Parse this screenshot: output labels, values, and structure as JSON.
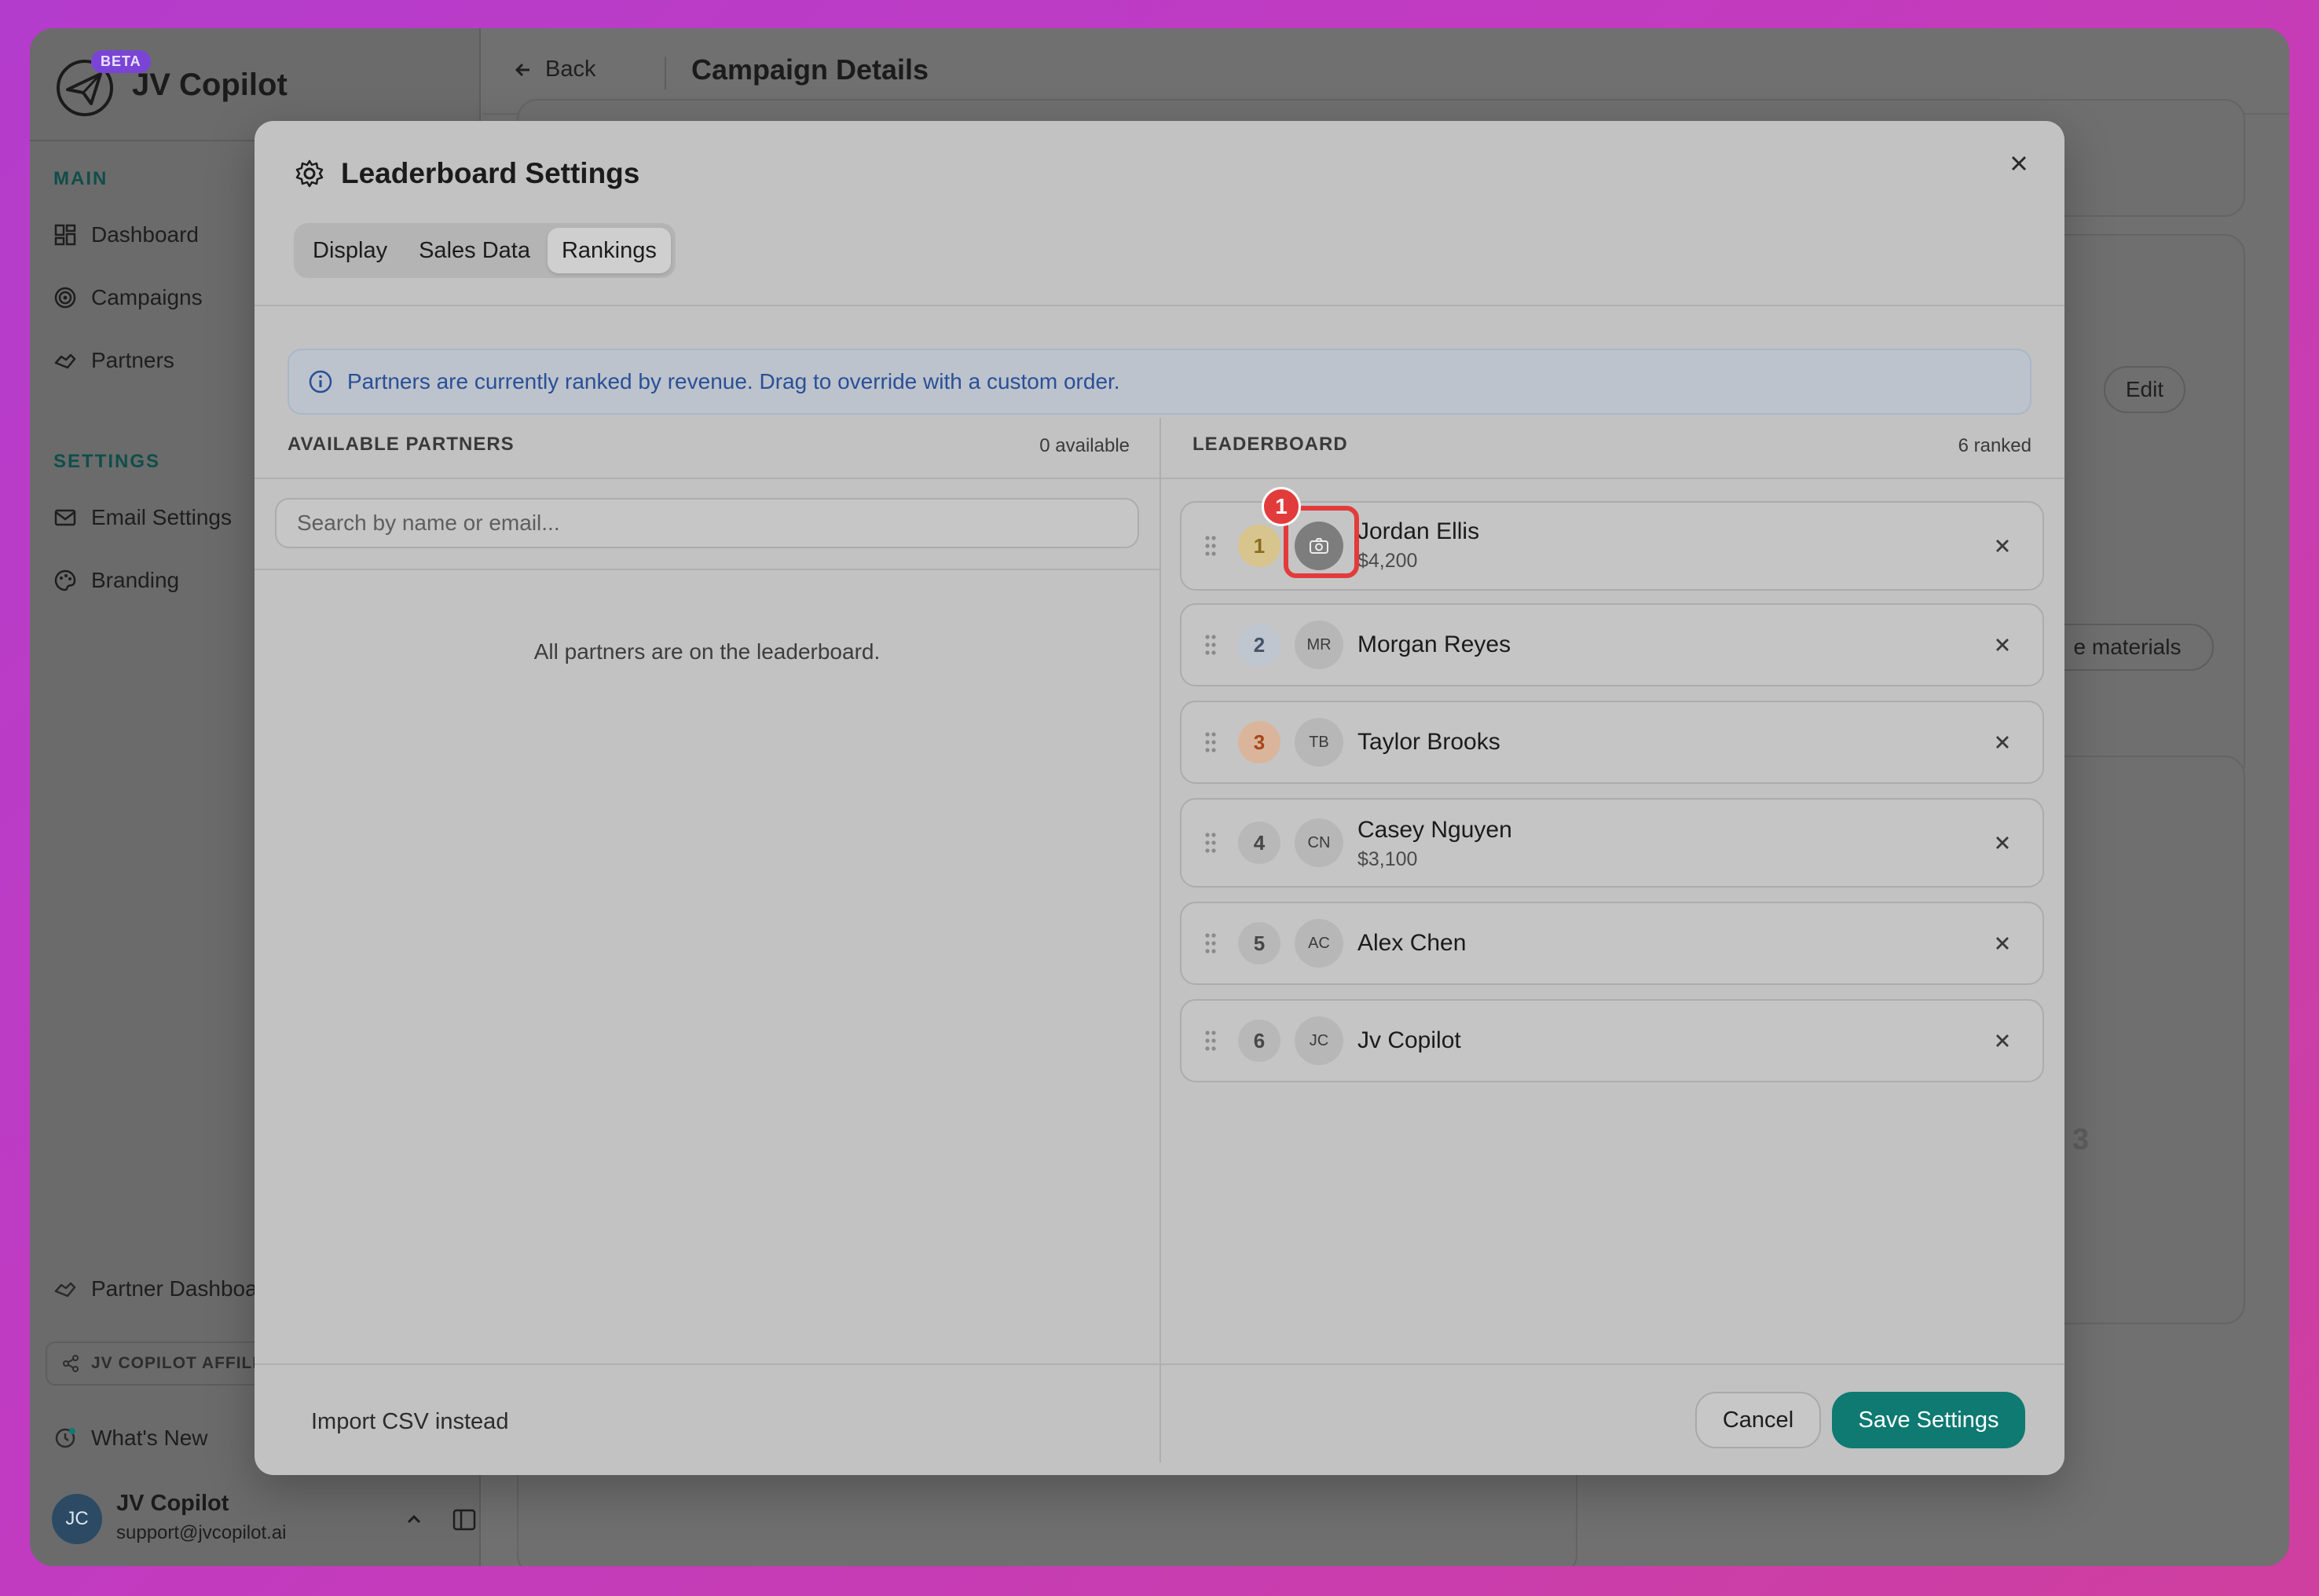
{
  "app": {
    "beta_label": "BETA",
    "name": "JV Copilot"
  },
  "sidebar": {
    "main_label": "MAIN",
    "main_items": [
      {
        "label": "Dashboard",
        "icon": "dashboard-icon"
      },
      {
        "label": "Campaigns",
        "icon": "target-icon"
      },
      {
        "label": "Partners",
        "icon": "handshake-icon"
      }
    ],
    "settings_label": "SETTINGS",
    "settings_items": [
      {
        "label": "Email Settings",
        "icon": "mail-icon"
      },
      {
        "label": "Branding",
        "icon": "palette-icon"
      }
    ],
    "partner_dashboard": "Partner Dashboa",
    "affiliate_label": "JV COPILOT AFFILI",
    "whats_new": "What's New",
    "user": {
      "initials": "JC",
      "name": "JV Copilot",
      "email": "support@jvcopilot.ai"
    }
  },
  "header": {
    "back_label": "Back",
    "title": "Campaign Details"
  },
  "background": {
    "edit_label": "Edit",
    "materials_label": "e materials",
    "number": "3"
  },
  "modal": {
    "title": "Leaderboard Settings",
    "tabs": [
      "Display",
      "Sales Data",
      "Rankings"
    ],
    "active_tab": "Rankings",
    "info": "Partners are currently ranked by revenue. Drag to override with a custom order.",
    "available": {
      "heading": "AVAILABLE PARTNERS",
      "count": "0 available",
      "search_placeholder": "Search by name or email...",
      "empty": "All partners are on the leaderboard."
    },
    "leaderboard": {
      "heading": "LEADERBOARD",
      "count": "6 ranked",
      "rows": [
        {
          "rank": "1",
          "initials": "",
          "name": "Jordan Ellis",
          "amount": "$4,200"
        },
        {
          "rank": "2",
          "initials": "MR",
          "name": "Morgan Reyes",
          "amount": ""
        },
        {
          "rank": "3",
          "initials": "TB",
          "name": "Taylor Brooks",
          "amount": ""
        },
        {
          "rank": "4",
          "initials": "CN",
          "name": "Casey Nguyen",
          "amount": "$3,100"
        },
        {
          "rank": "5",
          "initials": "AC",
          "name": "Alex Chen",
          "amount": ""
        },
        {
          "rank": "6",
          "initials": "JC",
          "name": "Jv Copilot",
          "amount": ""
        }
      ]
    },
    "step_badge": "1",
    "footer": {
      "import_label": "Import CSV instead",
      "cancel_label": "Cancel",
      "save_label": "Save Settings"
    }
  },
  "colors": {
    "accent": "#0e7a72",
    "highlight": "#e23b3b",
    "info_text": "#2a4f98",
    "rank_gold": "#d8c48d",
    "rank_silver": "#c0c6d0",
    "rank_bronze": "#dab59b"
  }
}
